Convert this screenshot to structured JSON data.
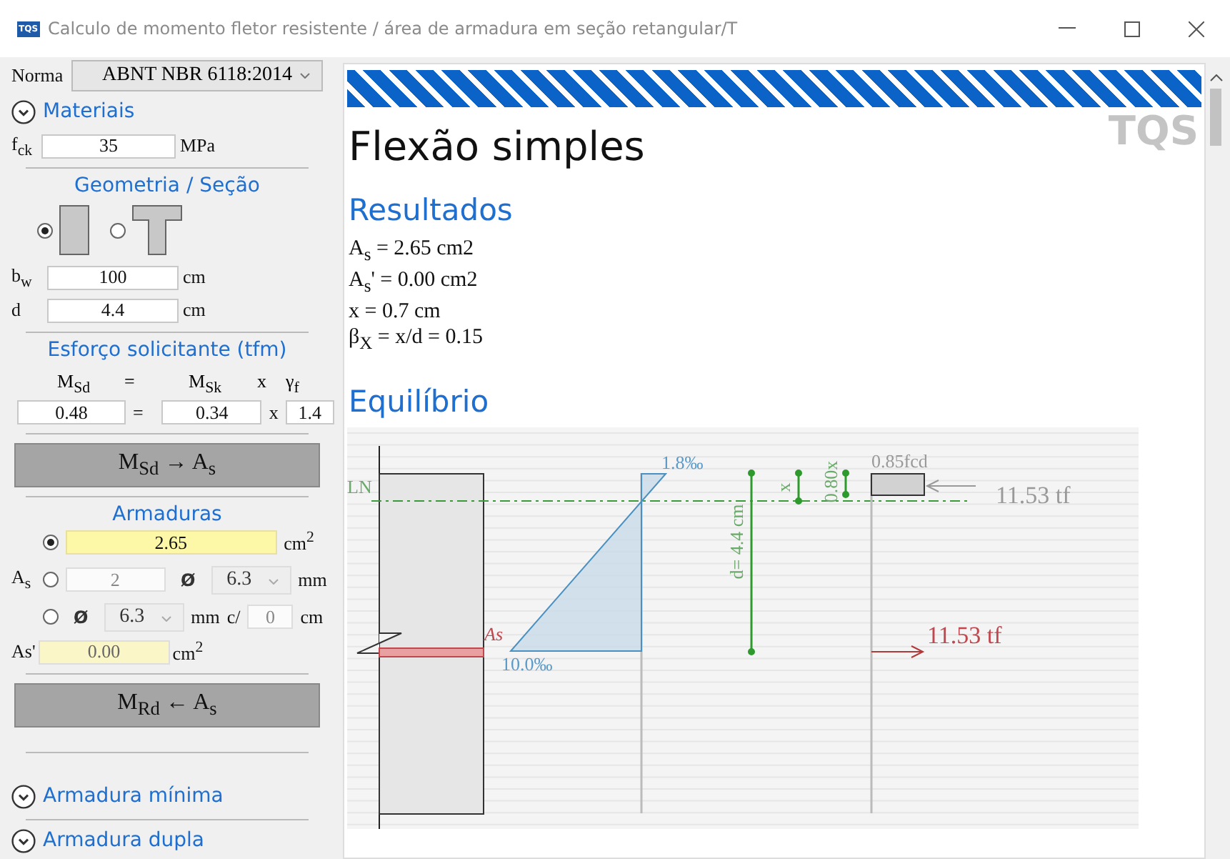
{
  "window": {
    "icon_text": "TQS",
    "title": "Calculo de momento fletor resistente / área de armadura em seção retangular/T"
  },
  "sidebar": {
    "norma": {
      "label": "Norma",
      "value": "ABNT NBR 6118:2014"
    },
    "materiais": {
      "title": "Materiais",
      "fck": {
        "label": "f$_{ck}$",
        "value": "35",
        "unit": "MPa"
      }
    },
    "geometria": {
      "title": "Geometria / Seção",
      "sections": [
        {
          "kind": "rect",
          "selected": true
        },
        {
          "kind": "tee",
          "selected": false
        }
      ],
      "fields": [
        {
          "label": "b$_{w}$",
          "value": "100",
          "unit": "cm"
        },
        {
          "label": "d",
          "value": "4.4",
          "unit": "cm"
        }
      ]
    },
    "esforco": {
      "title": "Esforço solicitante (tfm)",
      "headers": [
        "M$_{Sd}$",
        "=",
        "M$_{Sk}$",
        "x",
        "γ$_{f}$"
      ],
      "msd": "0.48",
      "eq": "=",
      "msk": "0.34",
      "times": "x",
      "gf": "1.4"
    },
    "calc_button": "M$_{Sd}$ → A$_{s}$",
    "armaduras": {
      "title": "Armaduras",
      "label": "A$_{s}$",
      "options": [
        {
          "kind": "area",
          "selected": true,
          "value": "2.65",
          "unit": "cm$^{2}$"
        },
        {
          "kind": "bars",
          "selected": false,
          "count": "2",
          "diam_symbol": "Ø",
          "diameter": "6.3",
          "unit": "mm"
        },
        {
          "kind": "spacing",
          "selected": false,
          "diam_symbol": "Ø",
          "diameter": "6.3",
          "unit": "mm",
          "sep": "c/",
          "spacing": "0",
          "spacing_unit": "cm"
        }
      ],
      "as_prime": {
        "label": "As'",
        "value": "0.00",
        "unit": "cm$^{2}$"
      }
    },
    "resist_button": "M$_{Rd}$ ← A$_{s}$",
    "collapsibles": [
      {
        "title": "Armadura mínima"
      },
      {
        "title": "Armadura dupla"
      }
    ]
  },
  "content": {
    "watermark": "TQS",
    "heading": "Flexão simples",
    "results_title": "Resultados",
    "results": [
      "A$_{s}$ = 2.65 cm2",
      "A$_{s}$' = 0.00 cm2",
      "x = 0.7 cm",
      "β$_{X}$ = x/d = 0.15"
    ],
    "equilibrium_title": "Equilíbrio",
    "diagram": {
      "ln": "LN",
      "as": "As",
      "strain_top": "1.8‰",
      "strain_bottom": "10.0‰",
      "d": "d=  4.4 cm",
      "x": "x",
      "x080": "0.80x",
      "fcd": "0.85fcd",
      "compression": "11.53 tf",
      "tension": "11.53 tf"
    }
  }
}
